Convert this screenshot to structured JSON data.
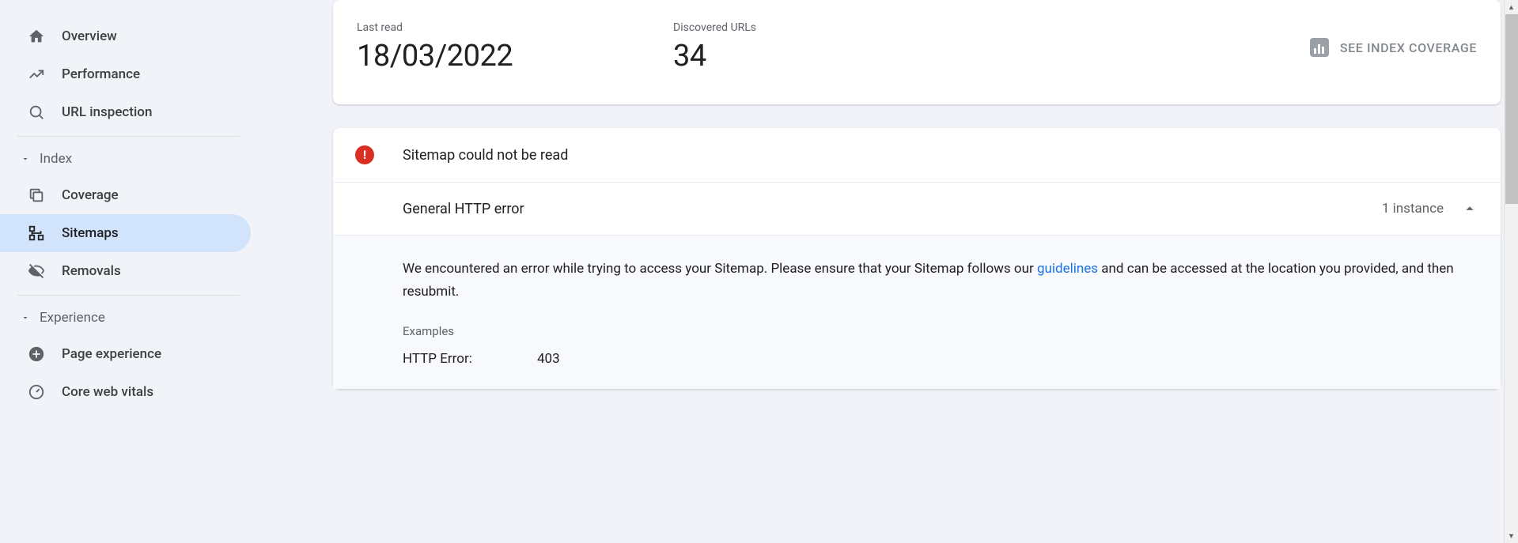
{
  "sidebar": {
    "items": [
      {
        "label": "Overview"
      },
      {
        "label": "Performance"
      },
      {
        "label": "URL inspection"
      }
    ],
    "section_index": {
      "label": "Index"
    },
    "index_items": [
      {
        "label": "Coverage"
      },
      {
        "label": "Sitemaps"
      },
      {
        "label": "Removals"
      }
    ],
    "section_experience": {
      "label": "Experience"
    },
    "experience_items": [
      {
        "label": "Page experience"
      },
      {
        "label": "Core web vitals"
      }
    ]
  },
  "stats": {
    "last_read_label": "Last read",
    "last_read_value": "18/03/2022",
    "discovered_label": "Discovered URLs",
    "discovered_value": "34",
    "action_label": "SEE INDEX COVERAGE"
  },
  "error": {
    "title": "Sitemap could not be read",
    "subtitle": "General HTTP error",
    "count_label": "1 instance",
    "desc_prefix": "We encountered an error while trying to access your Sitemap. Please ensure that your Sitemap follows our ",
    "guidelines_text": "guidelines",
    "desc_suffix": " and can be accessed at the location you provided, and then resubmit.",
    "examples_label": "Examples",
    "example_key": "HTTP Error:",
    "example_value": "403"
  }
}
